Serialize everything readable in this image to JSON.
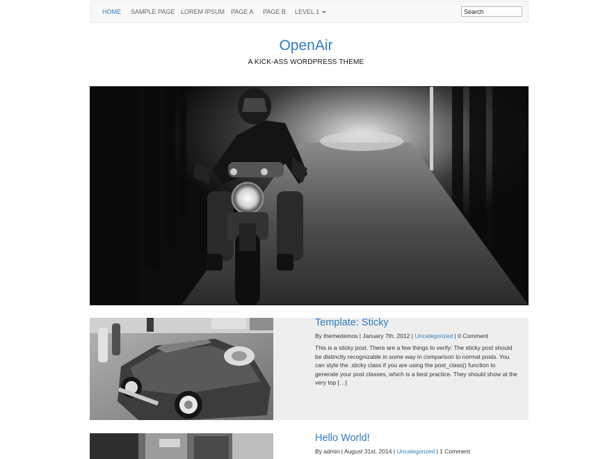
{
  "nav": {
    "items": [
      {
        "label": "Home",
        "active": true
      },
      {
        "label": "Sample Page"
      },
      {
        "label": "Lorem Ipsum"
      },
      {
        "label": "Page A"
      },
      {
        "label": "Page B"
      },
      {
        "label": "Level 1",
        "has_dropdown": true
      }
    ],
    "search_placeholder": "Search"
  },
  "site": {
    "title": "OpenAir",
    "description": "A KICK-ASS WORDPRESS THEME"
  },
  "hero": {
    "image": "motorcycle-rider-road-photo"
  },
  "posts": [
    {
      "title": "Template: Sticky",
      "author": "By themedemos",
      "date": "January 7th, 2012",
      "category": "Uncategorized",
      "comments": "0 Comment",
      "excerpt": "This is a sticky post. There are a few things to verify: The sticky post should be distinctly recognizable in some way in comparison to normal posts. You can style the .sticky class if you are using the post_class() function to generate your post classes, which is a best practice. They should show at the very top […]",
      "thumbnail": "vintage-convertible-car-photo"
    },
    {
      "title": "Hello World!",
      "author": "By admin",
      "date": "August 31st, 2014",
      "category": "Uncategorized",
      "comments": "1 Comment",
      "thumbnail": "street-scene-photo"
    }
  ],
  "separator": " | ",
  "colors": {
    "link": "#337ab7",
    "sticky_bg": "#eeeeee",
    "nav_bg": "#f8f8f8"
  }
}
